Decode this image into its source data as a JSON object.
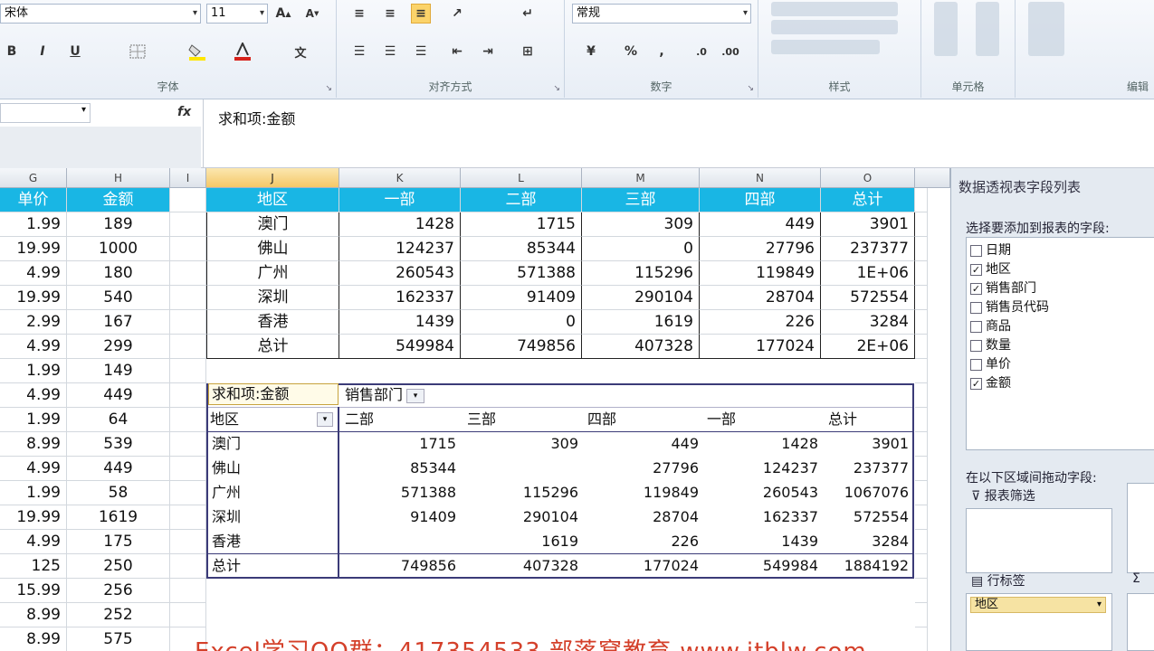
{
  "ribbon": {
    "font_name": "宋体",
    "font_size": "11",
    "number_format": "常规",
    "group_font": "字体",
    "group_alignment": "对齐方式",
    "group_number": "数字",
    "group_styles": "样式",
    "group_cells": "单元格",
    "group_editing": "编辑",
    "bold": "B",
    "italic": "I",
    "underline": "U",
    "percent": "%",
    "comma": ","
  },
  "formula_bar": {
    "fx": "fx",
    "content": "求和项:金额"
  },
  "columns": [
    "G",
    "H",
    "I",
    "J",
    "K",
    "L",
    "M",
    "N",
    "O"
  ],
  "left_table": {
    "headers": [
      "单价",
      "金额"
    ],
    "rows": [
      [
        "1.99",
        "189"
      ],
      [
        "19.99",
        "1000"
      ],
      [
        "4.99",
        "180"
      ],
      [
        "19.99",
        "540"
      ],
      [
        "2.99",
        "167"
      ],
      [
        "4.99",
        "299"
      ],
      [
        "1.99",
        "149"
      ],
      [
        "4.99",
        "449"
      ],
      [
        "1.99",
        "64"
      ],
      [
        "8.99",
        "539"
      ],
      [
        "4.99",
        "449"
      ],
      [
        "1.99",
        "58"
      ],
      [
        "19.99",
        "1619"
      ],
      [
        "4.99",
        "175"
      ],
      [
        "125",
        "250"
      ],
      [
        "15.99",
        "256"
      ],
      [
        "8.99",
        "252"
      ],
      [
        "8.99",
        "575"
      ]
    ]
  },
  "summary_table": {
    "headers": [
      "地区",
      "一部",
      "二部",
      "三部",
      "四部",
      "总计"
    ],
    "rows": [
      [
        "澳门",
        "1428",
        "1715",
        "309",
        "449",
        "3901"
      ],
      [
        "佛山",
        "124237",
        "85344",
        "0",
        "27796",
        "237377"
      ],
      [
        "广州",
        "260543",
        "571388",
        "115296",
        "119849",
        "1E+06"
      ],
      [
        "深圳",
        "162337",
        "91409",
        "290104",
        "28704",
        "572554"
      ],
      [
        "香港",
        "1439",
        "0",
        "1619",
        "226",
        "3284"
      ],
      [
        "总计",
        "549984",
        "749856",
        "407328",
        "177024",
        "2E+06"
      ]
    ]
  },
  "pivot": {
    "data_field": "求和项:金额",
    "column_field": "销售部门",
    "row_field": "地区",
    "col_headers": [
      "二部",
      "三部",
      "四部",
      "一部",
      "总计"
    ],
    "rows": [
      [
        "澳门",
        "1715",
        "309",
        "449",
        "1428",
        "3901"
      ],
      [
        "佛山",
        "85344",
        "",
        "27796",
        "124237",
        "237377"
      ],
      [
        "广州",
        "571388",
        "115296",
        "119849",
        "260543",
        "1067076"
      ],
      [
        "深圳",
        "91409",
        "290104",
        "28704",
        "162337",
        "572554"
      ],
      [
        "香港",
        "",
        "1619",
        "226",
        "1439",
        "3284"
      ],
      [
        "总计",
        "749856",
        "407328",
        "177024",
        "549984",
        "1884192"
      ]
    ]
  },
  "field_pane": {
    "title": "数据透视表字段列表",
    "choose_label": "选择要添加到报表的字段:",
    "fields": [
      {
        "name": "日期",
        "checked": false
      },
      {
        "name": "地区",
        "checked": true
      },
      {
        "name": "销售部门",
        "checked": true
      },
      {
        "name": "销售员代码",
        "checked": false
      },
      {
        "name": "商品",
        "checked": false
      },
      {
        "name": "数量",
        "checked": false
      },
      {
        "name": "单价",
        "checked": false
      },
      {
        "name": "金额",
        "checked": true
      }
    ],
    "drag_label": "在以下区域间拖动字段:",
    "report_filter": "报表筛选",
    "row_labels": "行标签",
    "row_field_value": "地区",
    "sigma": "Σ"
  },
  "watermark": "Excel学习QQ群：417354533 部落窝教育 www.itblw.com"
}
